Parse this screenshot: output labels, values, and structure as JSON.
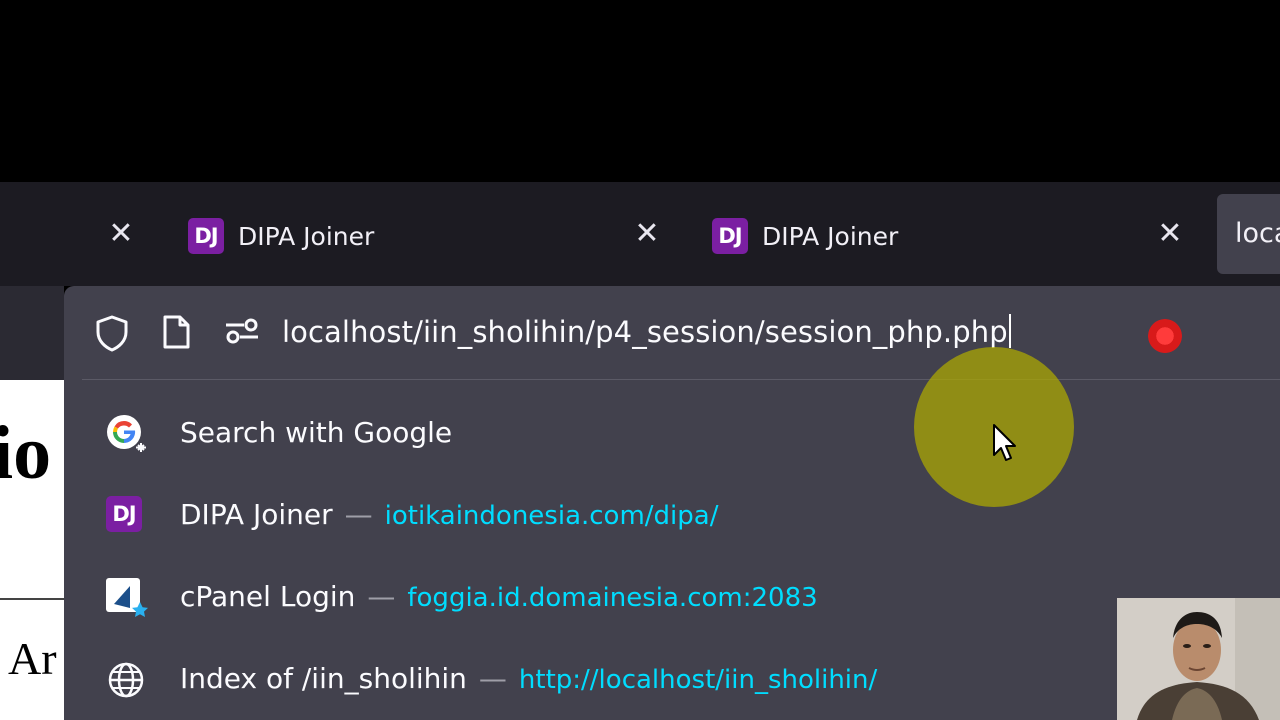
{
  "tabs": [
    {
      "label": "DIPA Joiner",
      "favicon": "DJ"
    },
    {
      "label": "DIPA Joiner",
      "favicon": "DJ"
    },
    {
      "label": "loca"
    }
  ],
  "page_behind": {
    "heading_fragment": "io",
    "text_fragment": "Ar"
  },
  "urlbar": {
    "value": "localhost/iin_sholihin/p4_session/session_php.php",
    "icons": [
      "shield-icon",
      "page-icon",
      "permissions-icon"
    ]
  },
  "suggestions": [
    {
      "title": "Search with Google",
      "icon": "google-search-icon"
    },
    {
      "title": "DIPA Joiner",
      "separator": "—",
      "url": "iotikaindonesia.com/dipa/",
      "icon": "DJ"
    },
    {
      "title": "cPanel Login",
      "separator": "—",
      "url": "foggia.id.domainesia.com:2083",
      "icon": "cpanel-bookmark-icon"
    },
    {
      "title": "Index of /iin_sholihin",
      "separator": "—",
      "url": "http://localhost/iin_sholihin/",
      "icon": "globe-icon"
    }
  ],
  "colors": {
    "tabstrip": "#1c1b22",
    "urlbar_bg": "#42414d",
    "url_link": "#00ddff",
    "dj_badge": "#7b1fa2",
    "cursor_highlight": "#afaa00"
  }
}
